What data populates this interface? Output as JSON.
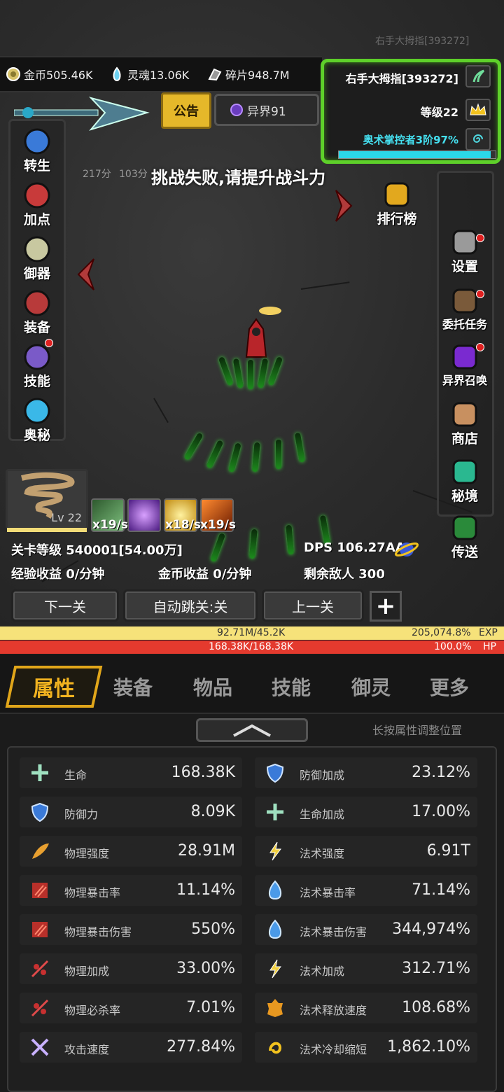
{
  "watermark": "右手大拇指[393272]",
  "resources": {
    "gold": "金币505.46K",
    "soul": "灵魂13.06K",
    "shard": "碎片948.7M"
  },
  "player": {
    "name": "右手大拇指[393272]",
    "level": "等级22",
    "rank": "奥术掌控者3阶97%",
    "exp_progress_pct": 97
  },
  "buttons": {
    "notice": "公告",
    "realm": "异界91"
  },
  "left_menu": [
    "转生",
    "加点",
    "御器",
    "装备",
    "技能",
    "奥秘"
  ],
  "right_menu": [
    "排行榜",
    "设置",
    "委托任务",
    "异界召唤",
    "商店",
    "秘境",
    "传送"
  ],
  "scores": [
    "217分",
    "103分"
  ],
  "message": "挑战失败,请提升战斗力",
  "hero_level": "Lv 22",
  "skills": [
    "x19/s",
    "x18/s",
    "x19/s"
  ],
  "stats": {
    "stage": "关卡等级 540001[54.00万]",
    "dps": "DPS  106.27AA",
    "exp_income": "经验收益 0/分钟",
    "gold_income": "金币收益 0/分钟",
    "enemies_left": "剩余敌人 300"
  },
  "nav_buttons": {
    "next": "下一关",
    "auto": "自动跳关:关",
    "prev": "上一关"
  },
  "bars": {
    "exp_value": "92.71M/45.2K",
    "exp_pct": "205,074.8%",
    "exp_tag": "EXP",
    "hp_value": "168.38K/168.38K",
    "hp_pct": "100.0%",
    "hp_tag": "HP"
  },
  "tabs": [
    "属性",
    "装备",
    "物品",
    "技能",
    "御灵",
    "更多"
  ],
  "hint": "长按属性调整位置",
  "attributes_left": [
    {
      "name": "生命",
      "value": "168.38K",
      "icon": "plus-icon"
    },
    {
      "name": "防御力",
      "value": "8.09K",
      "icon": "shield-icon"
    },
    {
      "name": "物理强度",
      "value": "28.91M",
      "icon": "feather-icon"
    },
    {
      "name": "物理暴击率",
      "value": "11.14%",
      "icon": "claw-icon"
    },
    {
      "name": "物理暴击伤害",
      "value": "550%",
      "icon": "claw-icon"
    },
    {
      "name": "物理加成",
      "value": "33.00%",
      "icon": "slash-icon"
    },
    {
      "name": "物理必杀率",
      "value": "7.01%",
      "icon": "slash-icon"
    },
    {
      "name": "攻击速度",
      "value": "277.84%",
      "icon": "swords-icon"
    }
  ],
  "attributes_right": [
    {
      "name": "防御加成",
      "value": "23.12%",
      "icon": "shield-icon"
    },
    {
      "name": "生命加成",
      "value": "17.00%",
      "icon": "plus-icon"
    },
    {
      "name": "法术强度",
      "value": "6.91T",
      "icon": "lightning-icon"
    },
    {
      "name": "法术暴击率",
      "value": "71.14%",
      "icon": "blue-flame-icon"
    },
    {
      "name": "法术暴击伤害",
      "value": "344,974%",
      "icon": "blue-flame-icon"
    },
    {
      "name": "法术加成",
      "value": "312.71%",
      "icon": "lightning-icon"
    },
    {
      "name": "法术释放速度",
      "value": "108.68%",
      "icon": "fire-icon"
    },
    {
      "name": "法术冷却缩短",
      "value": "1,862.10%",
      "icon": "swirl-icon"
    }
  ]
}
